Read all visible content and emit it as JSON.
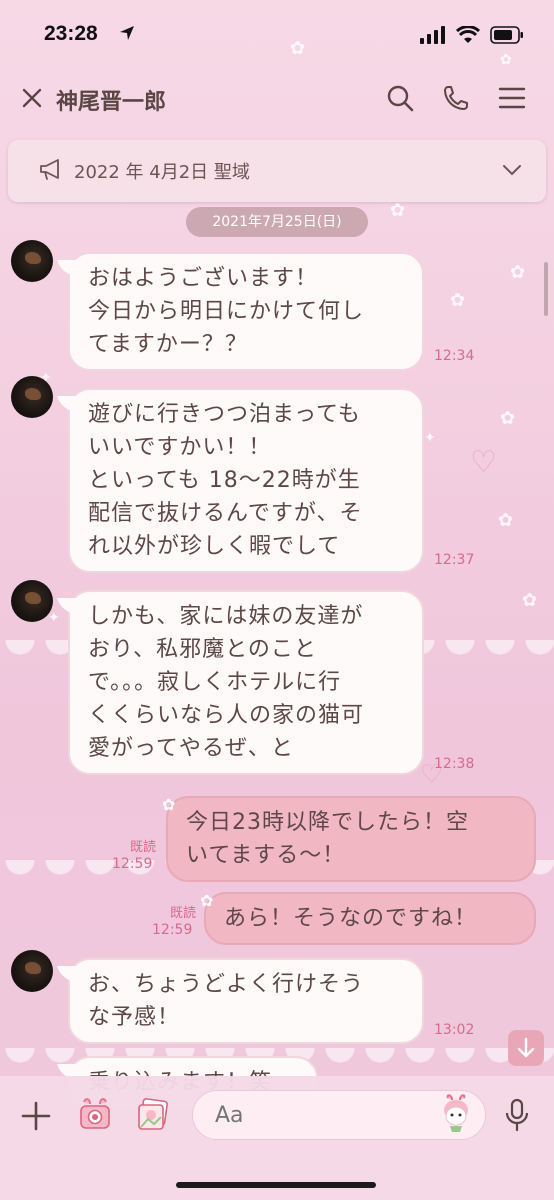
{
  "status_bar": {
    "time": "23:28"
  },
  "header": {
    "contact_name": "神尾晋一郎"
  },
  "announcement": {
    "text": "2022 年 4月2日 聖域"
  },
  "date_chip": {
    "label": "2021年7月25日(日)"
  },
  "messages": [
    {
      "side": "in",
      "text": "おはようございます！\n今日から明日にかけて何し\nてますかー？？",
      "time": "12:34"
    },
    {
      "side": "in",
      "text": "遊びに行きつつ泊まっても\nいいですかい！！\nといっても 18～22時が生\n配信で抜けるんですが、そ\nれ以外が珍しく暇でして",
      "time": "12:37"
    },
    {
      "side": "in",
      "text": "しかも、家には妹の友達が\nおり、私邪魔とのこと\nで。。。寂しくホテルに行\nくくらいなら人の家の猫可\n愛がってやるぜ、と",
      "time": "12:38"
    },
    {
      "side": "out",
      "text": "今日23時以降でしたら！空\nいてまする〜！",
      "time": "12:59",
      "read": "既読"
    },
    {
      "side": "out",
      "text": "あら！そうなのですね！",
      "time": "12:59",
      "read": "既読"
    },
    {
      "side": "in",
      "text": "お、ちょうどよく行けそう\nな予感！",
      "time": "13:02"
    },
    {
      "side": "in",
      "text": "乗り込みます！笑",
      "time": ""
    }
  ],
  "input": {
    "placeholder": "Aa"
  },
  "colors": {
    "accent": "#d86a8a",
    "bubble_out": "#f1b8c4",
    "bubble_in": "#fffafa",
    "background": "#f3cfe0"
  },
  "icons": [
    "close-icon",
    "search-icon",
    "phone-icon",
    "menu-icon",
    "megaphone-icon",
    "chevron-down-icon",
    "plus-icon",
    "camera-icon",
    "photo-icon",
    "sticker-icon",
    "mic-icon",
    "arrow-down-icon"
  ]
}
